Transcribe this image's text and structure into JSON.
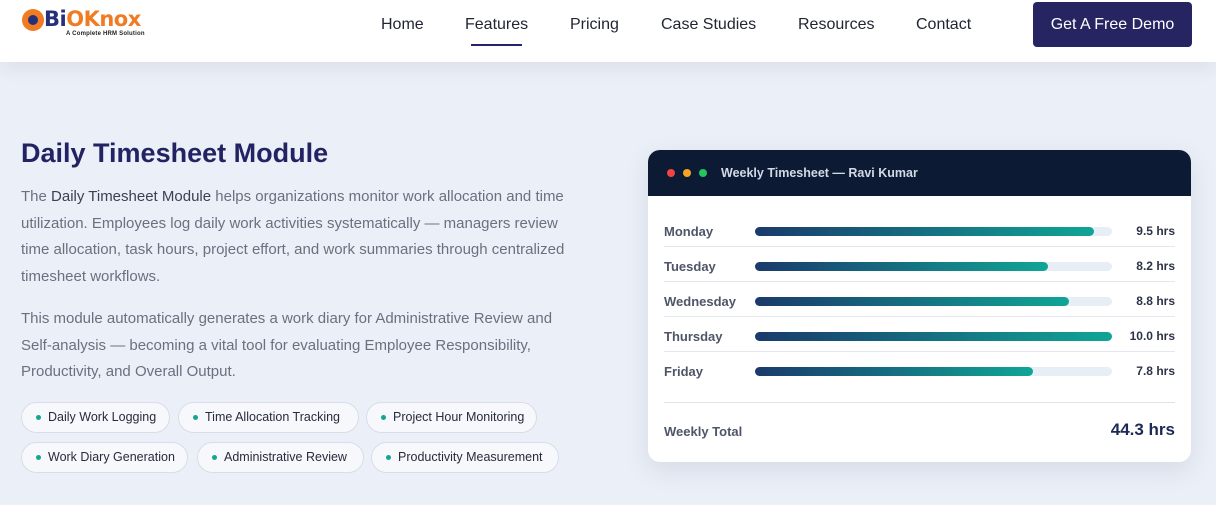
{
  "brand": {
    "name_part1": "Bi",
    "name_part2": "O",
    "name_part3": "Knox",
    "tagline": "A Complete HRM Solution",
    "colors": {
      "navy": "#26307a",
      "orange": "#f07b23"
    }
  },
  "nav": {
    "items": [
      {
        "label": "Home",
        "active": false
      },
      {
        "label": "Features",
        "active": true
      },
      {
        "label": "Pricing",
        "active": false
      },
      {
        "label": "Case Studies",
        "active": false
      },
      {
        "label": "Resources",
        "active": false
      },
      {
        "label": "Contact",
        "active": false
      }
    ],
    "cta_label": "Get A Free Demo"
  },
  "section": {
    "title": "Daily Timesheet Module",
    "para1_prefix": "The ",
    "para1_strong": "Daily Timesheet Module",
    "para1_rest": " helps organizations monitor work allocation and time utilization. Employees log daily work activities systematically — managers review time allocation, task hours, project effort, and work summaries through centralized timesheet workflows.",
    "para2": "This module automatically generates a work diary for Administrative Review and Self-analysis — becoming a vital tool for evaluating Employee Responsibility, Productivity, and Overall Output.",
    "chips": [
      "Daily Work Logging",
      "Time Allocation Tracking",
      "Project Hour Monitoring",
      "Work Diary Generation",
      "Administrative Review",
      "Productivity Measurement"
    ]
  },
  "timesheet": {
    "title": "Weekly Timesheet — Ravi Kumar",
    "window_dot_colors": [
      "#ef4444",
      "#f5a524",
      "#22c55e"
    ],
    "days": [
      {
        "day": "Monday",
        "hours": 9.5,
        "label": "9.5 hrs"
      },
      {
        "day": "Tuesday",
        "hours": 8.2,
        "label": "8.2 hrs"
      },
      {
        "day": "Wednesday",
        "hours": 8.8,
        "label": "8.8 hrs"
      },
      {
        "day": "Thursday",
        "hours": 10.0,
        "label": "10.0 hrs"
      },
      {
        "day": "Friday",
        "hours": 7.8,
        "label": "7.8 hrs"
      }
    ],
    "max_hours": 10.0,
    "total_label": "Weekly Total",
    "total_value": "44.3 hrs"
  }
}
